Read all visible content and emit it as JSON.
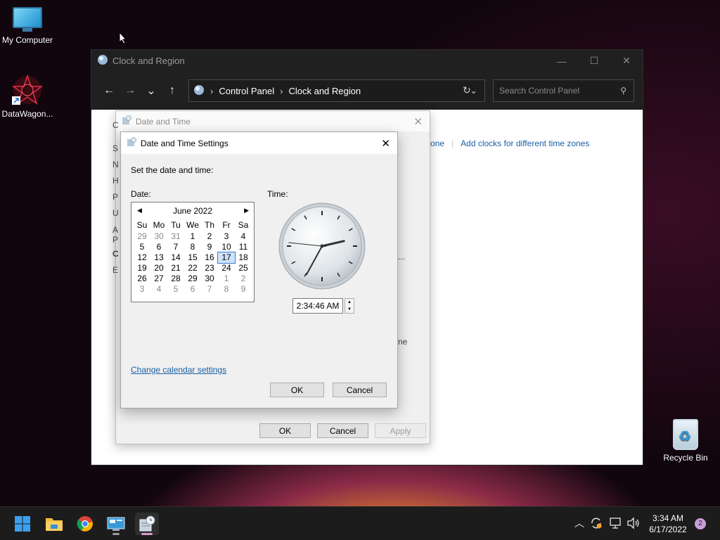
{
  "desktop": {
    "icons": [
      {
        "label": "My Computer",
        "icon": "computer-icon"
      },
      {
        "label": "DataWagon...",
        "icon": "shortcut-icon"
      },
      {
        "label": "Recycle Bin",
        "icon": "recycle-bin-icon"
      }
    ]
  },
  "cp_window": {
    "title": "Clock and Region",
    "breadcrumb": [
      "Control Panel",
      "Clock and Region"
    ],
    "search_placeholder": "Search Control Panel",
    "links": [
      "zone",
      "Add clocks for different time zones"
    ]
  },
  "dt_dialog": {
    "title": "Date and Time",
    "buttons": {
      "ok": "OK",
      "cancel": "Cancel",
      "apply": "Apply"
    },
    "fragments": [
      "C",
      "S",
      "N",
      "H",
      "P",
      "U",
      "A",
      "P",
      "C",
      "E",
      "...",
      "ne"
    ]
  },
  "dts_dialog": {
    "title": "Date and Time Settings",
    "prompt": "Set the date and time:",
    "date_label": "Date:",
    "time_label": "Time:",
    "calendar": {
      "month": "June 2022",
      "weekdays": [
        "Su",
        "Mo",
        "Tu",
        "We",
        "Th",
        "Fr",
        "Sa"
      ],
      "weeks": [
        [
          "29",
          "30",
          "31",
          "1",
          "2",
          "3",
          "4"
        ],
        [
          "5",
          "6",
          "7",
          "8",
          "9",
          "10",
          "11"
        ],
        [
          "12",
          "13",
          "14",
          "15",
          "16",
          "17",
          "18"
        ],
        [
          "19",
          "20",
          "21",
          "22",
          "23",
          "24",
          "25"
        ],
        [
          "26",
          "27",
          "28",
          "29",
          "30",
          "1",
          "2"
        ],
        [
          "3",
          "4",
          "5",
          "6",
          "7",
          "8",
          "9"
        ]
      ],
      "selected": "17"
    },
    "clock": {
      "hour": 2,
      "minute": 34,
      "second": 46
    },
    "time_value": "2:34:46 AM",
    "change_calendar_link": "Change calendar settings",
    "ok": "OK",
    "cancel": "Cancel"
  },
  "taskbar": {
    "clock_time": "3:34 AM",
    "clock_date": "6/17/2022",
    "notification_count": "2",
    "tray_icons": [
      "chevron-up-icon",
      "sync-icon",
      "network-icon",
      "volume-icon"
    ],
    "accent_color": "#d999d0"
  }
}
